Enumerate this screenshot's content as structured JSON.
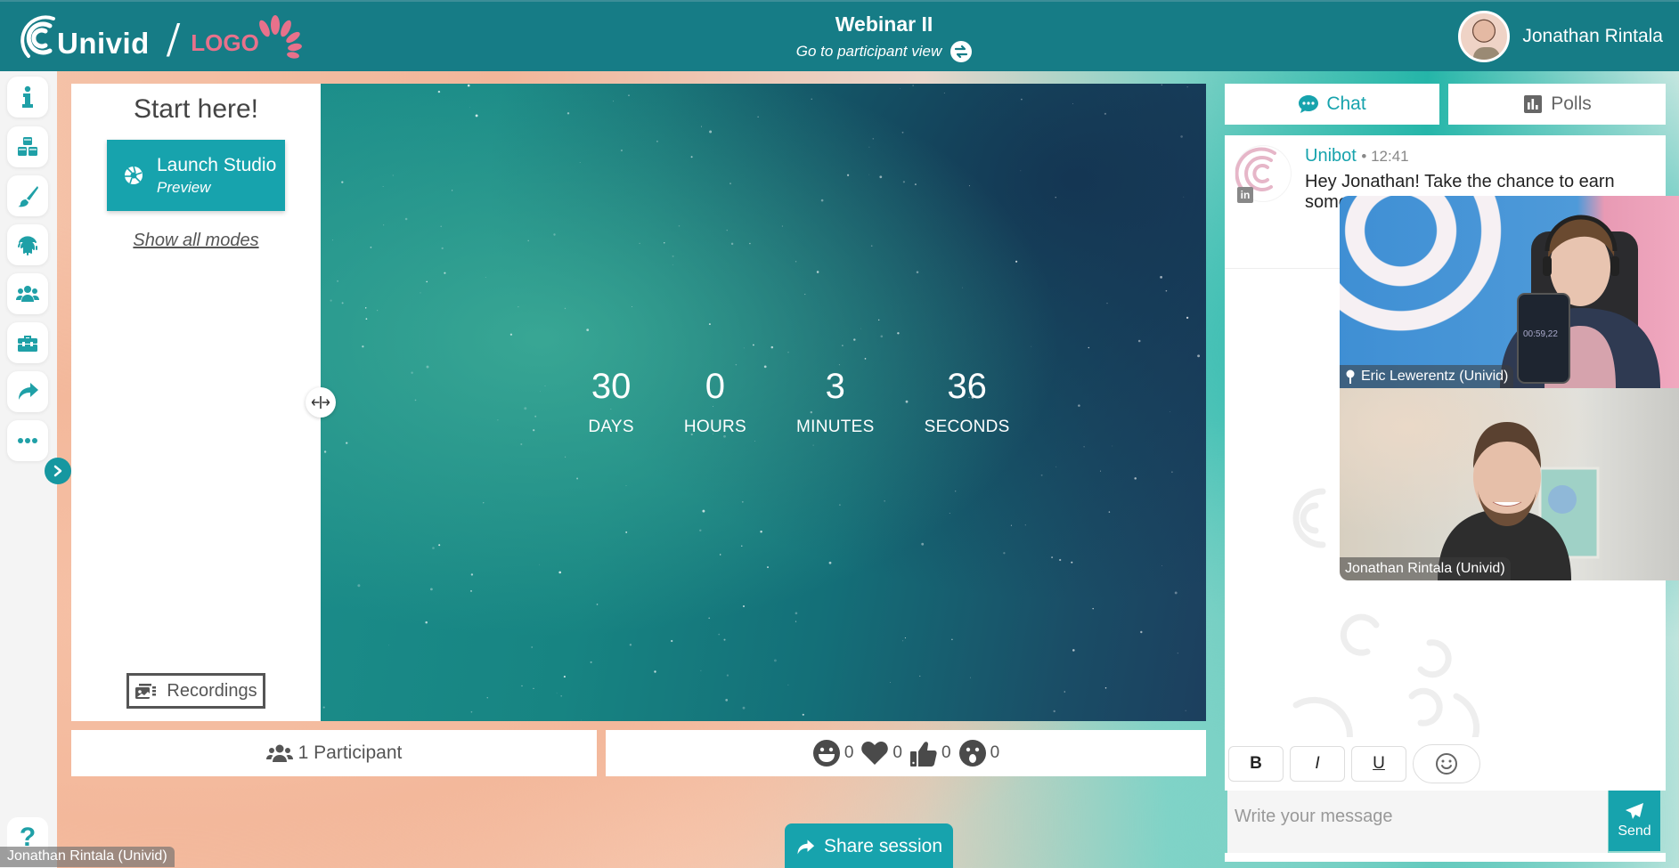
{
  "header": {
    "brand_logo_text": "Univid",
    "partner_logo_text": "LOGO",
    "webinar_title": "Webinar II",
    "participant_view_link": "Go to participant view",
    "user_name": "Jonathan Rintala"
  },
  "rail": {
    "items": [
      {
        "icon": "info-icon",
        "label": "Info"
      },
      {
        "icon": "cubes-icon",
        "label": "Content"
      },
      {
        "icon": "paint-brush-icon",
        "label": "Branding"
      },
      {
        "icon": "fingerprint-icon",
        "label": "Registration"
      },
      {
        "icon": "users-icon",
        "label": "Participants"
      },
      {
        "icon": "toolbox-icon",
        "label": "Tools"
      },
      {
        "icon": "share-icon",
        "label": "Share"
      },
      {
        "icon": "more-icon",
        "label": "More"
      }
    ],
    "help_label": "?"
  },
  "modes_panel": {
    "heading": "Start here!",
    "launch_title": "Launch Studio",
    "launch_subtitle": "Preview",
    "show_all_modes": "Show all modes",
    "recordings": "Recordings"
  },
  "countdown": {
    "units": [
      {
        "value": "30",
        "label": "DAYS"
      },
      {
        "value": "0",
        "label": "HOURS"
      },
      {
        "value": "3",
        "label": "MINUTES"
      },
      {
        "value": "36",
        "label": "SECONDS"
      }
    ]
  },
  "participants": {
    "label": "1 Participant"
  },
  "reactions": [
    {
      "icon": "laughing-face-icon",
      "count": "0"
    },
    {
      "icon": "heart-icon",
      "count": "0"
    },
    {
      "icon": "thumbs-up-icon",
      "count": "0"
    },
    {
      "icon": "surprised-face-icon",
      "count": "0"
    }
  ],
  "share_session": "Share session",
  "self_view_label": "Jonathan Rintala (Univid)",
  "right_panel": {
    "tabs": [
      {
        "label": "Chat",
        "active": true
      },
      {
        "label": "Polls",
        "active": false
      }
    ],
    "messages": [
      {
        "author": "Unibot",
        "time": "12:41",
        "text": "Hey Jonathan! Take the chance to earn some… some…"
      }
    ],
    "format_buttons": {
      "bold": "B",
      "italic": "I",
      "underline": "U"
    },
    "input_placeholder": "Write your message",
    "send_label": "Send"
  },
  "videos": [
    {
      "name": "Eric Lewerentz (Univid)",
      "pinned": true
    },
    {
      "name": "Jonathan Rintala (Univid)",
      "pinned": false
    }
  ],
  "colors": {
    "header_bg": "#167c86",
    "accent": "#17a3ad",
    "brand_pink": "#e8718b"
  }
}
